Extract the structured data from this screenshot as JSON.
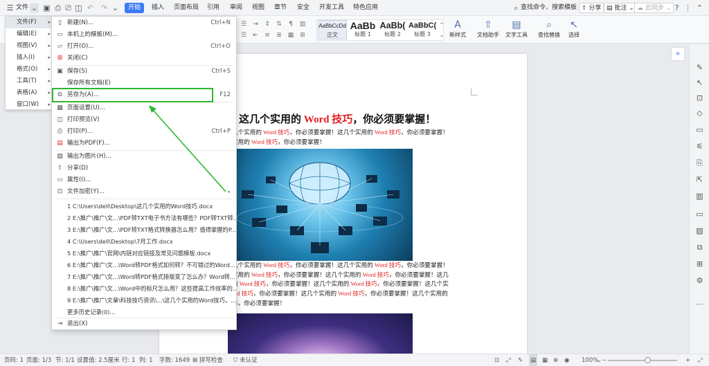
{
  "topbar": {
    "file_label": "文件",
    "tabs": [
      "开始",
      "插入",
      "页面布局",
      "引用",
      "审阅",
      "视图",
      "章节",
      "安全",
      "开发工具",
      "特色应用"
    ],
    "search_placeholder": "查找命令、搜索模板",
    "share_label": "分享",
    "comment_label": "批注",
    "cloud_label": "云同步"
  },
  "ribbon": {
    "styles": [
      {
        "preview": "AaBbCcDd",
        "label": "正文"
      },
      {
        "preview": "AaBb",
        "label": "标题 1"
      },
      {
        "preview": "AaBb(",
        "label": "标题 2"
      },
      {
        "preview": "AaBbC(",
        "label": "标题 3"
      }
    ],
    "new_style": "新样式",
    "doc_assistant": "文档助手",
    "text_tools": "文字工具",
    "find_replace": "查找替换",
    "select": "选择"
  },
  "left_menu": [
    {
      "label": "文件(F)",
      "active": true
    },
    {
      "label": "编辑(E)",
      "active": false
    },
    {
      "label": "视图(V)",
      "active": false
    },
    {
      "label": "插入(I)",
      "active": false
    },
    {
      "label": "格式(O)",
      "active": false
    },
    {
      "label": "工具(T)",
      "active": false
    },
    {
      "label": "表格(A)",
      "active": false
    },
    {
      "label": "窗口(W)",
      "active": false
    }
  ],
  "file_menu": {
    "new": {
      "label": "新建(N)...",
      "shortcut": "Ctrl+N"
    },
    "template": {
      "label": "本机上的模板(M)..."
    },
    "open": {
      "label": "打开(O)...",
      "shortcut": "Ctrl+O"
    },
    "close": {
      "label": "关闭(C)"
    },
    "save": {
      "label": "保存(S)",
      "shortcut": "Ctrl+S"
    },
    "save_all": {
      "label": "保存所有文档(E)"
    },
    "save_as": {
      "label": "另存为(A)...",
      "shortcut": "F12"
    },
    "page_setup": {
      "label": "页面设置(U)..."
    },
    "print_preview": {
      "label": "打印预览(V)"
    },
    "print": {
      "label": "打印(P)...",
      "shortcut": "Ctrl+P"
    },
    "export_pdf": {
      "label": "输出为PDF(F)..."
    },
    "export_image": {
      "label": "输出为图片(H)..."
    },
    "share": {
      "label": "分享(D)"
    },
    "properties": {
      "label": "属性(I)..."
    },
    "encrypt": {
      "label": "文件加密(Y)..."
    },
    "recent": [
      "1 C:\\Users\\dell\\Desktop\\这几个实用的Word技巧.docx",
      "2 E:\\推广\\推广\\文...\\PDF转TXT电子书方法有哪些？PDF转TXT转...",
      "3 E:\\推广\\推广\\文...\\PDF转TXT格式转换器怎么用？值得掌握的P...",
      "4 C:\\Users\\dell\\Desktop\\7月工作.docx",
      "5 E:\\推广\\推广\\官网\\内链对应链接及常见问题模板.docx",
      "6 E:\\推广\\推广\\文...\\Word转PDF格式如何转？不可错过的Word...",
      "7 E:\\推广\\推广\\文...\\Word转PDF格式排版变了怎么办？Word转...",
      "8 E:\\推广\\推广\\文...\\Word中的标尺怎么用？这些提高工作效率的...",
      "9 E:\\推广\\推广\\文章\\科技技巧资讯\\...\\这几个实用的Word技巧，...",
      "更多历史记录(0)..."
    ],
    "exit": {
      "label": "退出(X)"
    }
  },
  "document": {
    "title_pre": "这几个实用的 ",
    "title_red": "Word 技巧",
    "title_post": "，你必须要掌握！",
    "p1": [
      {
        "t": "几个实用的 "
      },
      {
        "t": "Word 技巧",
        "red": true
      },
      {
        "t": "，你必须要掌握！这几个实用的 "
      },
      {
        "t": "Word 技巧",
        "red": true
      },
      {
        "t": "，你必须要掌握！"
      }
    ],
    "p1b": [
      {
        "t": "实用的 "
      },
      {
        "t": "Word 技巧",
        "red": true
      },
      {
        "t": "，你必须要掌握！"
      }
    ],
    "p2": [
      [
        {
          "t": "几个实用的 "
        },
        {
          "t": "Word 技巧",
          "red": true
        },
        {
          "t": "，你必须要掌握！这几个实用的 "
        },
        {
          "t": "Word 技巧",
          "red": true
        },
        {
          "t": "，你必须要掌握！"
        }
      ],
      [
        {
          "t": "实用的 "
        },
        {
          "t": "Word 技巧",
          "red": true
        },
        {
          "t": "，你必须要掌握！这几个实用的 "
        },
        {
          "t": "Word 技巧",
          "red": true
        },
        {
          "t": "，你必须要掌握！这几"
        }
      ],
      [
        {
          "t": "的 "
        },
        {
          "t": "Word 技巧",
          "red": true
        },
        {
          "t": "，你必须要掌握！这几个实用的 "
        },
        {
          "t": "Word 技巧",
          "red": true
        },
        {
          "t": "，你必须要掌握！这几个实"
        }
      ],
      [
        {
          "t": "ord 技巧",
          "red": true
        },
        {
          "t": "，你必须要掌握！这几个实用的 "
        },
        {
          "t": "Word 技巧",
          "red": true
        },
        {
          "t": "，你必须要掌握！这几个实用的"
        }
      ],
      [
        {
          "t": "巧",
          "red": true
        },
        {
          "t": "，你必须要掌握！"
        }
      ]
    ]
  },
  "statusbar": {
    "page_num": "页码: 1",
    "pages": "页面: 1/3",
    "section": "节: 1/1",
    "setting": "设置值: 2.5厘米",
    "row": "行: 1",
    "col": "列: 1",
    "words": "字数: 1649",
    "spell": "拼写检查",
    "cert": "未认证",
    "zoom": "100%"
  }
}
